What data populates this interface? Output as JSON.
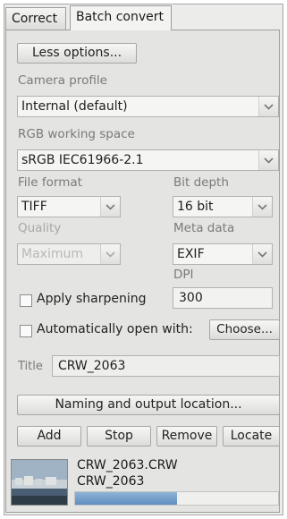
{
  "tabs": [
    {
      "label": "Correct",
      "active": false
    },
    {
      "label": "Batch convert",
      "active": true
    }
  ],
  "less_options_label": "Less options...",
  "camera_profile": {
    "label": "Camera profile",
    "value": "Internal (default)"
  },
  "rgb_working_space": {
    "label": "RGB working space",
    "value": "sRGB IEC61966-2.1"
  },
  "file_format": {
    "label": "File format",
    "value": "TIFF"
  },
  "bit_depth": {
    "label": "Bit depth",
    "value": "16 bit"
  },
  "quality": {
    "label": "Quality",
    "value": "Maximum"
  },
  "meta_data": {
    "label": "Meta data",
    "value": "EXIF"
  },
  "dpi": {
    "label": "DPI",
    "value": "300"
  },
  "apply_sharpening": {
    "label": "Apply sharpening",
    "checked": false
  },
  "auto_open": {
    "label": "Automatically open with:",
    "checked": false,
    "choose_label": "Choose..."
  },
  "title": {
    "label": "Title",
    "value": "CRW_2063"
  },
  "naming_button_label": "Naming and output location...",
  "actions": {
    "add": "Add",
    "stop": "Stop",
    "remove": "Remove",
    "locate": "Locate"
  },
  "queue": [
    {
      "filename": "CRW_2063.CRW",
      "title": "CRW_2063",
      "progress": 0.5
    }
  ],
  "colors": {
    "progress_fill": "#6f9bc8",
    "panel_bg": "#e4e4e2"
  }
}
